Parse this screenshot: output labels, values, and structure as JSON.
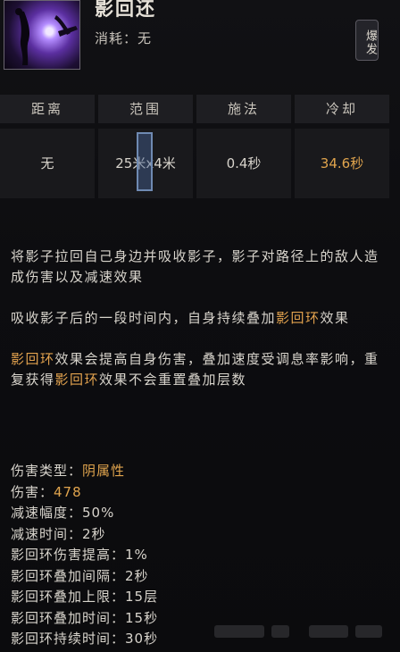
{
  "skill": {
    "name": "影回还",
    "cost_label": "消耗：",
    "cost_value": "无",
    "tag": "爆发"
  },
  "stats": {
    "columns": [
      {
        "header": "距离",
        "value": "无"
      },
      {
        "header": "范围",
        "value": "25米x4米"
      },
      {
        "header": "施法",
        "value": "0.4秒"
      },
      {
        "header": "冷却",
        "value": "34.6秒"
      }
    ]
  },
  "description": {
    "p1": "将影子拉回自己身边并吸收影子，影子对路径上的敌人造成伤害以及减速效果",
    "p2_text": "吸收影子后的一段时间内，自身持续叠加",
    "p2_highlight": "影回环",
    "p2_suffix": "效果",
    "p3_highlight1": "影回环",
    "p3_text1": "效果会提高自身伤害，叠加速度受调息率影响，重复获得",
    "p3_highlight2": "影回环",
    "p3_text2": "效果不会重置叠加层数"
  },
  "attributes": [
    {
      "label": "伤害类型：",
      "value": "阴属性",
      "gold": true
    },
    {
      "label": "伤害：",
      "value": "478",
      "gold": true
    },
    {
      "label": "减速幅度：",
      "value": "50%",
      "gold": false
    },
    {
      "label": "减速时间：",
      "value": "2秒",
      "gold": false
    },
    {
      "label": "影回环伤害提高：",
      "value": "1%",
      "gold": false
    },
    {
      "label": "影回环叠加间隔：",
      "value": "2秒",
      "gold": false
    },
    {
      "label": "影回环叠加上限：",
      "value": "15层",
      "gold": false
    },
    {
      "label": "影回环叠加时间：",
      "value": "15秒",
      "gold": false
    },
    {
      "label": "影回环持续时间：",
      "value": "30秒",
      "gold": false
    }
  ],
  "colors": {
    "accent_gold": "#e0a44d",
    "background": "#0c0c0e"
  }
}
